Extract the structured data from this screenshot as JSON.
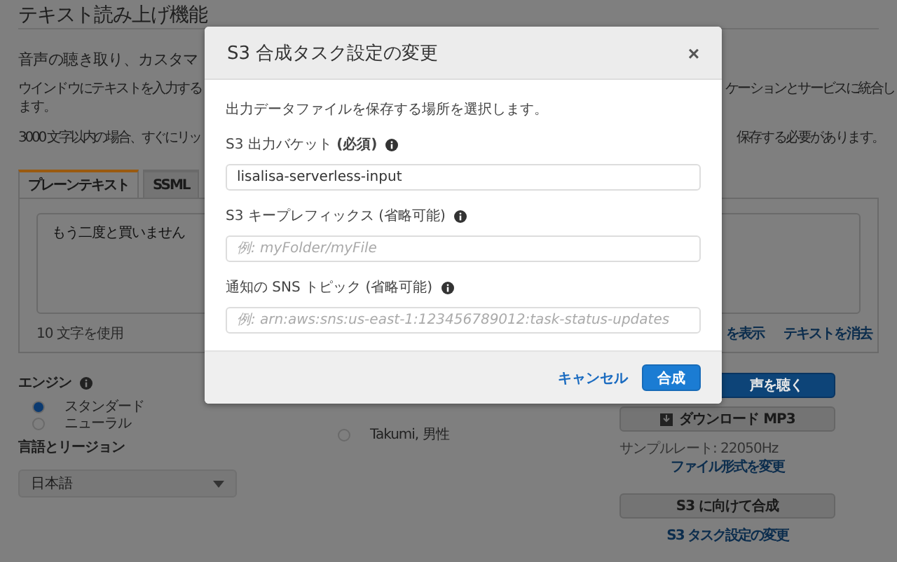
{
  "page": {
    "title": "テキスト読み上げ機能",
    "subtitle": "音声の聴き取り、カスタマ",
    "intro_row": {
      "left": "ウインドウにテキストを入力する",
      "right": "ケーションとサービスに統合し"
    },
    "intro_tail": "ます。",
    "limit_row": {
      "left": "3000 文字以内の場合、すぐにリッ",
      "right": "保存する必要があります。"
    },
    "tabs": [
      {
        "label": "プレーンテキスト",
        "selected": true
      },
      {
        "label": "SSML",
        "selected": false
      }
    ],
    "text_input": {
      "value": "もう二度と買いません"
    },
    "char_count": "10 文字を使用",
    "text_links": [
      "を表示",
      "テキストを消去"
    ],
    "engine": {
      "label": "エンジン",
      "options": [
        {
          "label": "スタンダード",
          "selected": true
        },
        {
          "label": "ニューラル",
          "selected": false
        }
      ]
    },
    "language": {
      "label": "言語とリージョン",
      "value": "日本語"
    },
    "voices": [
      {
        "label": "Takumi, 男性",
        "selected": false
      }
    ],
    "listen_button": "声を聴く",
    "download_button": "ダウンロード MP3",
    "sample_rate": "サンプルレート: 22050Hz",
    "change_format_link": "ファイル形式を変更",
    "s3_button": "S3 に向けて合成",
    "s3_settings_link": "S3 タスク設定の変更"
  },
  "dialog": {
    "title": "S3 合成タスク設定の変更",
    "close": "×",
    "description": "出力データファイルを保存する場所を選択します。",
    "fields": [
      {
        "label": "S3 出力バケット **(必須)**",
        "value": "lisalisa-serverless-input"
      },
      {
        "label": "S3 キープレフィックス (省略可能)",
        "placeholder": "例: myFolder/myFile"
      },
      {
        "label": "通知の SNS トピック (省略可能)",
        "placeholder": "例: arn:aws:sns:us-east-1:123456789012:task-status-updates"
      }
    ],
    "buttons": [
      {
        "label": "キャンセル",
        "kind": "link"
      },
      {
        "label": "合成",
        "kind": "primary"
      }
    ]
  }
}
